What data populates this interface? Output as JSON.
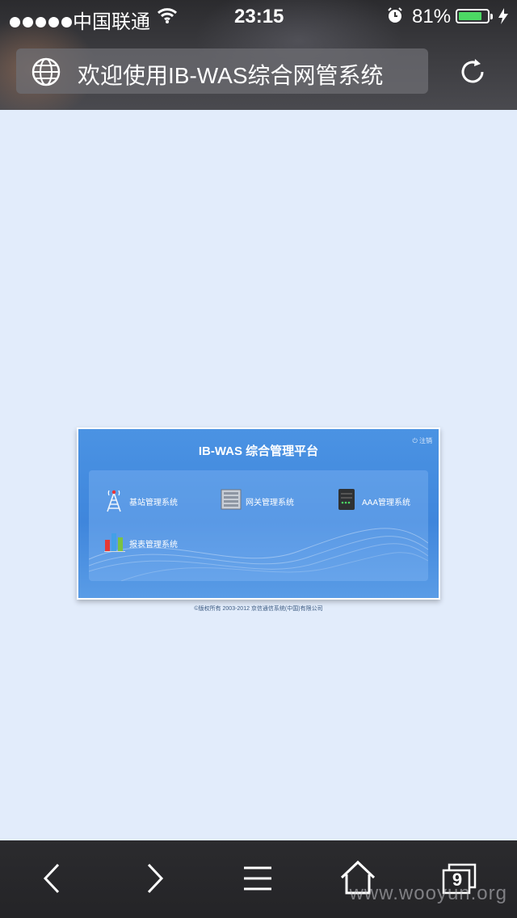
{
  "status_bar": {
    "carrier": "中国联通",
    "time": "23:15",
    "battery_percent": "81%",
    "battery_level": 0.81,
    "signal_bars": 5,
    "wifi_icon": "wifi-icon",
    "alarm_icon": "alarm-icon",
    "charging_icon": "bolt-icon"
  },
  "browser": {
    "page_title": "欢迎使用IB-WAS综合网管系统",
    "globe_icon": "globe-icon",
    "reload_icon": "reload-icon",
    "tab_count": "9"
  },
  "portal": {
    "title": "IB-WAS 综合管理平台",
    "logout": "注销",
    "modules": [
      {
        "label": "基站管理系统",
        "icon": "tower-icon"
      },
      {
        "label": "网关管理系统",
        "icon": "gateway-icon"
      },
      {
        "label": "AAA管理系统",
        "icon": "server-icon"
      },
      {
        "label": "报表管理系统",
        "icon": "report-chart-icon"
      }
    ],
    "copyright": "©版权所有 2003-2012 京信通信系统(中国)有限公司"
  },
  "toolbar": {
    "back_icon": "back-icon",
    "forward_icon": "forward-icon",
    "menu_icon": "menu-icon",
    "home_icon": "home-icon",
    "tabs_icon": "tabs-icon"
  },
  "watermark": "www.wooyun.org",
  "colors": {
    "page_background": "#e2ecfb",
    "panel_blue": "#4b93e3",
    "bars": "#2b2b2e",
    "battery_green": "#4cd964"
  }
}
